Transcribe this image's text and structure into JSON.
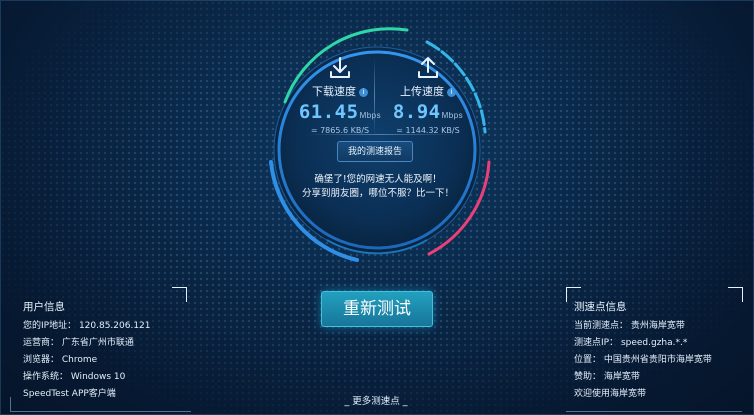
{
  "download": {
    "label": "下载速度",
    "value": "61.45",
    "unit": "Mbps",
    "sub": "= 7865.6 KB/S",
    "icon": "download-icon"
  },
  "upload": {
    "label": "上传速度",
    "value": "8.94",
    "unit": "Mbps",
    "sub": "= 1144.32 KB/S",
    "icon": "upload-icon"
  },
  "info_icon_glyph": "i",
  "report_button": "我的测速报告",
  "slogan": {
    "line1": "确堡了!您的网速无人能及啊！",
    "line2": "分享到朋友圈，哪位不服？比一下！"
  },
  "retest_button": "重新测试",
  "more_nodes_link": "_ 更多测速点 _",
  "user_info": {
    "title": "用户信息",
    "rows": [
      "您的IP地址： 120.85.206.121",
      "运营商： 广东省广州市联通",
      "浏览器： Chrome",
      "操作系统： Windows 10",
      "SpeedTest APP客户端"
    ]
  },
  "node_info": {
    "title": "测速点信息",
    "rows": [
      "当前测速点： 贵州海岸宽带",
      "测速点IP： speed.gzha.*.*",
      "位置： 中国贵州省贵阳市海岸宽带",
      "赞助： 海岸宽带",
      "欢迎使用海岸宽带"
    ]
  },
  "colors": {
    "background": "#071a33",
    "speed_value": "#6fc6ff",
    "arc_green": "#2fd7a8",
    "arc_blue": "#2f8fe6",
    "arc_pink": "#e8407a",
    "button_cyan": "#22a0bf"
  }
}
